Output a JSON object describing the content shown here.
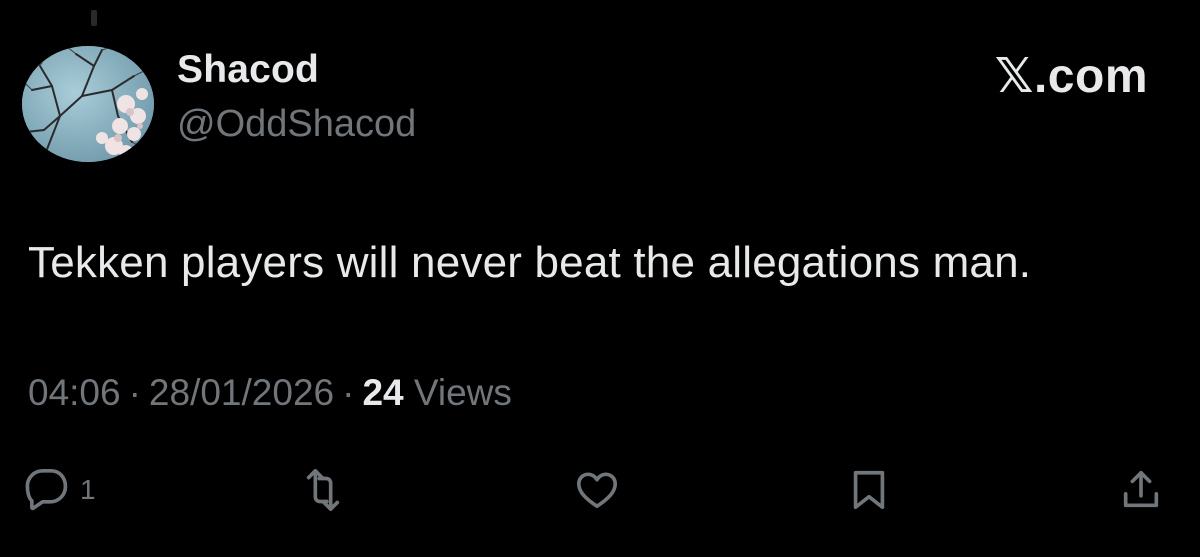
{
  "author": {
    "display_name": "Shacod",
    "handle": "@OddShacod"
  },
  "brand": {
    "logo_text": "𝕏.com"
  },
  "tweet": {
    "text": "Tekken players will never beat the allegations man.",
    "time": "04:06",
    "date": "28/01/2026",
    "views_count": "24",
    "views_label": "Views",
    "separator": "·"
  },
  "actions": {
    "reply_icon": "reply-icon",
    "reply_count": "1",
    "repost_icon": "repost-icon",
    "like_icon": "heart-icon",
    "bookmark_icon": "bookmark-icon",
    "share_icon": "share-icon"
  },
  "colors": {
    "background": "#000000",
    "primary_text": "#e7e9ea",
    "secondary_text": "#71767b"
  }
}
